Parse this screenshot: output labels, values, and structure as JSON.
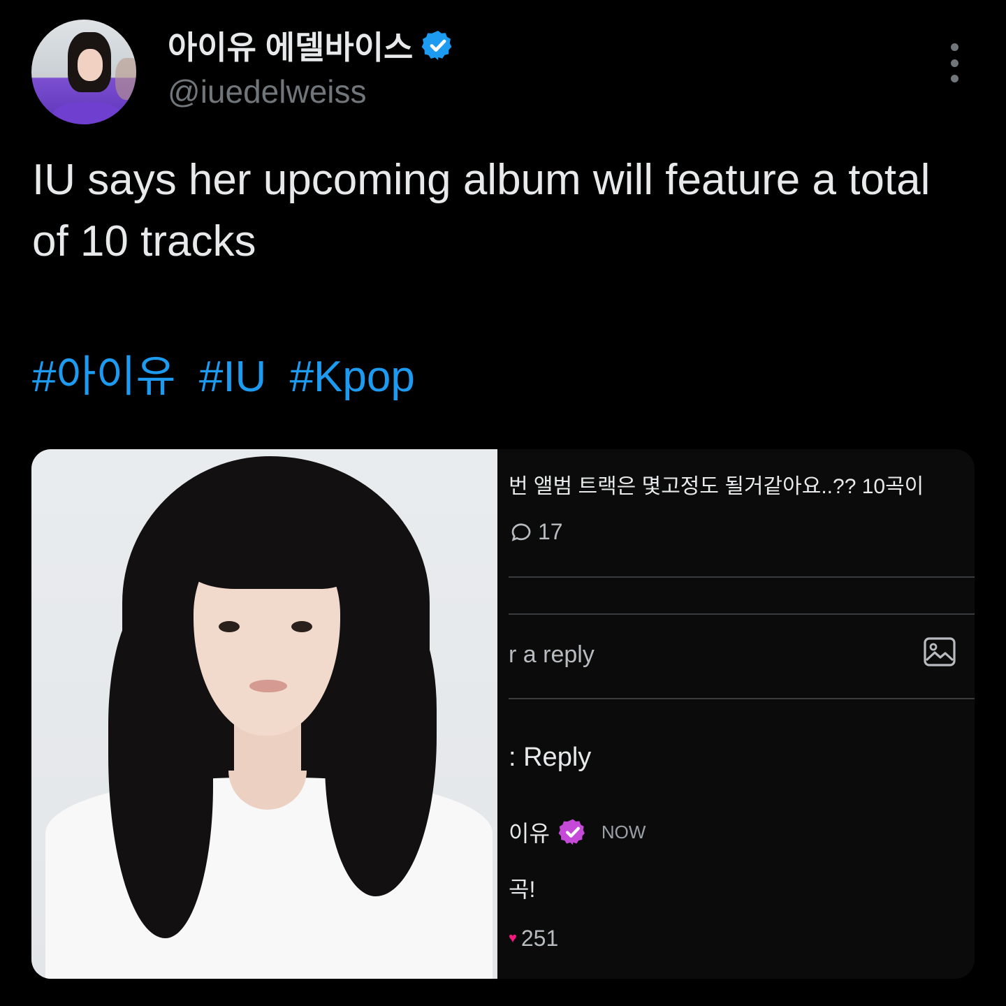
{
  "tweet": {
    "display_name": "아이유 에델바이스",
    "handle": "@iuedelweiss",
    "text": "IU says her upcoming album will feature a total of 10 tracks",
    "hashtags": [
      "#아이유",
      "#IU",
      "#Kpop"
    ]
  },
  "icons": {
    "verified": "verified-badge-icon",
    "more": "more-vertical-icon",
    "comment": "comment-bubble-icon",
    "image": "image-icon",
    "heart": "heart-icon"
  },
  "colors": {
    "background": "#000000",
    "text": "#e7e9ea",
    "muted": "#71767b",
    "link": "#1d9bf0",
    "verified": "#1d9bf0",
    "badge_purple": "#c54ad8"
  },
  "embedded_screenshot": {
    "question": "번 앨범 트랙은 몇고정도 될거같아요..?? 10곡이",
    "comment_count": "17",
    "reply_placeholder": "r a reply",
    "reply_button": ": Reply",
    "author": "이유",
    "time": "NOW",
    "answer": "곡!",
    "like_count": "251"
  }
}
